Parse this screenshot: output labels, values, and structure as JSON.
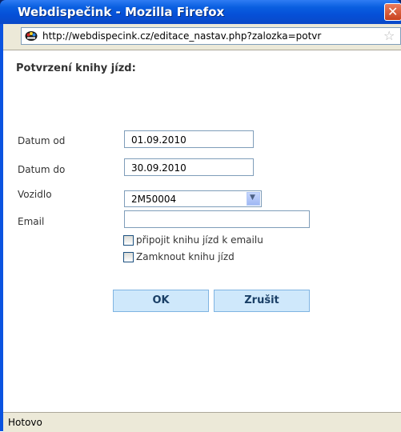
{
  "window": {
    "title": "Webdispečink - Mozilla Firefox"
  },
  "addressbar": {
    "url": "http://webdispecink.cz/editace_nastav.php?zalozka=potvr"
  },
  "form": {
    "heading": "Potvrzení knihy jízd:",
    "date_from_label": "Datum od",
    "date_from_value": "01.09.2010",
    "date_to_label": "Datum do",
    "date_to_value": "30.09.2010",
    "vehicle_label": "Vozidlo",
    "vehicle_value": "2M50004",
    "email_label": "Email",
    "email_value": "",
    "attach_label": "připojit knihu jízd k emailu",
    "attach_checked": false,
    "lock_label": "Zamknout knihu jízd",
    "lock_checked": false,
    "ok_label": "OK",
    "cancel_label": "Zrušit"
  },
  "statusbar": {
    "text": "Hotovo"
  },
  "colors": {
    "titlebar": "#0a5fe0",
    "button_bg": "#cfe8fb",
    "button_text": "#1a3f66"
  },
  "icons": {
    "close": "close-icon",
    "site": "site-icon",
    "bookmark": "star-icon",
    "dropdown": "chevron-down-icon"
  }
}
